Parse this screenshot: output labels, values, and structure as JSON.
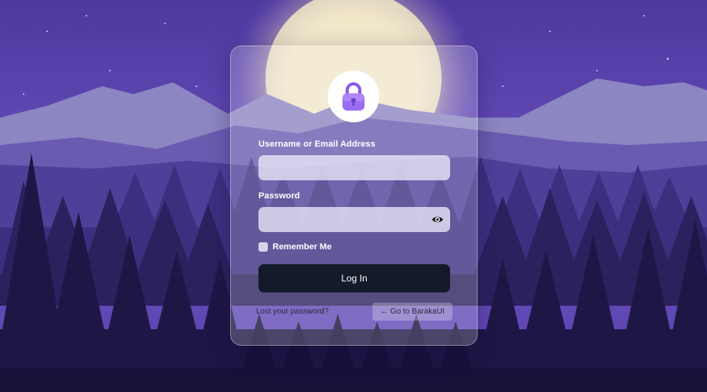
{
  "login_form": {
    "username_label": "Username or Email Address",
    "username_value": "",
    "password_label": "Password",
    "password_value": "",
    "remember_label": "Remember Me",
    "login_button": "Log In",
    "lost_password_link": "Lost your password?",
    "back_link": "← Go to BarakaUI"
  },
  "icons": {
    "logo": "padlock-icon",
    "password_toggle": "eye-icon"
  },
  "colors": {
    "sky_top": "#4f3aa0",
    "sky_mid": "#6b4ec2",
    "moon": "#f3eacb",
    "button": "#131a29",
    "logo_accent": "#9b6df0"
  }
}
